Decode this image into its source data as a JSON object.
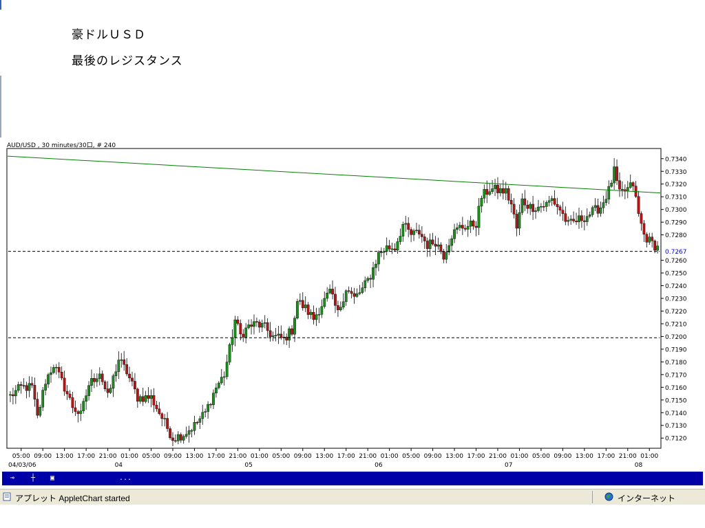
{
  "page": {
    "heading1": "豪ドルＵＳＤ",
    "heading2": "最後のレジスタンス"
  },
  "chart_data": {
    "type": "candlestick",
    "title": "AUD/USD , 30 minutes/30口, # 240",
    "current_price": "0.7267",
    "ylim": [
      0.7112,
      0.7348
    ],
    "y_ticks": [
      "0.7120",
      "0.7130",
      "0.7140",
      "0.7150",
      "0.7160",
      "0.7170",
      "0.7180",
      "0.7190",
      "0.7200",
      "0.7210",
      "0.7220",
      "0.7230",
      "0.7240",
      "0.7250",
      "0.7260",
      "0.7280",
      "0.7290",
      "0.7300",
      "0.7310",
      "0.7320",
      "0.7330",
      "0.7340"
    ],
    "x_time_ticks": [
      "05:00",
      "09:00",
      "13:00",
      "17:00",
      "21:00",
      "01:00",
      "05:00",
      "09:00",
      "13:00",
      "17:00",
      "21:00",
      "01:00",
      "05:00",
      "09:00",
      "13:00",
      "17:00",
      "21:00",
      "01:00",
      "05:00",
      "09:00",
      "13:00",
      "17:00",
      "21:00",
      "01:00",
      "05:00",
      "09:00",
      "13:00",
      "17:00",
      "21:00",
      "01:00"
    ],
    "x_date_labels": [
      {
        "label": "04/03/06",
        "bar": 0
      },
      {
        "label": "04",
        "bar": 40
      },
      {
        "label": "05",
        "bar": 88
      },
      {
        "label": "06",
        "bar": 136
      },
      {
        "label": "07",
        "bar": 184
      },
      {
        "label": "08",
        "bar": 232
      }
    ],
    "horizontal_lines": [
      0.7267,
      0.7199
    ],
    "trendline": {
      "start": 0.7342,
      "end": 0.7313
    },
    "colors": {
      "up": "#1e8c1e",
      "down": "#b01818",
      "trend": "#008000",
      "level": "#000000",
      "current": "#0000cc",
      "frame": "#000000"
    },
    "anchors": [
      {
        "bar": 0,
        "close": 0.7153
      },
      {
        "bar": 4,
        "close": 0.716
      },
      {
        "bar": 8,
        "close": 0.716
      },
      {
        "bar": 10,
        "close": 0.7136
      },
      {
        "bar": 13,
        "close": 0.7165
      },
      {
        "bar": 16,
        "close": 0.7178
      },
      {
        "bar": 20,
        "close": 0.716
      },
      {
        "bar": 23,
        "close": 0.7145
      },
      {
        "bar": 26,
        "close": 0.7138
      },
      {
        "bar": 29,
        "close": 0.7162
      },
      {
        "bar": 33,
        "close": 0.7172
      },
      {
        "bar": 36,
        "close": 0.7152
      },
      {
        "bar": 40,
        "close": 0.7182
      },
      {
        "bar": 43,
        "close": 0.7172
      },
      {
        "bar": 47,
        "close": 0.7152
      },
      {
        "bar": 52,
        "close": 0.7152
      },
      {
        "bar": 57,
        "close": 0.7132
      },
      {
        "bar": 60,
        "close": 0.712
      },
      {
        "bar": 64,
        "close": 0.7123
      },
      {
        "bar": 68,
        "close": 0.713
      },
      {
        "bar": 72,
        "close": 0.714
      },
      {
        "bar": 76,
        "close": 0.716
      },
      {
        "bar": 79,
        "close": 0.717
      },
      {
        "bar": 81,
        "close": 0.719
      },
      {
        "bar": 83,
        "close": 0.7213
      },
      {
        "bar": 85,
        "close": 0.7201
      },
      {
        "bar": 88,
        "close": 0.7208
      },
      {
        "bar": 91,
        "close": 0.721
      },
      {
        "bar": 94,
        "close": 0.7207
      },
      {
        "bar": 97,
        "close": 0.72
      },
      {
        "bar": 101,
        "close": 0.7198
      },
      {
        "bar": 104,
        "close": 0.7205
      },
      {
        "bar": 106,
        "close": 0.7228
      },
      {
        "bar": 109,
        "close": 0.7222
      },
      {
        "bar": 112,
        "close": 0.7214
      },
      {
        "bar": 115,
        "close": 0.7225
      },
      {
        "bar": 118,
        "close": 0.7235
      },
      {
        "bar": 121,
        "close": 0.7218
      },
      {
        "bar": 124,
        "close": 0.7238
      },
      {
        "bar": 127,
        "close": 0.723
      },
      {
        "bar": 130,
        "close": 0.7237
      },
      {
        "bar": 133,
        "close": 0.7248
      },
      {
        "bar": 136,
        "close": 0.7265
      },
      {
        "bar": 139,
        "close": 0.727
      },
      {
        "bar": 142,
        "close": 0.727
      },
      {
        "bar": 145,
        "close": 0.7288
      },
      {
        "bar": 148,
        "close": 0.728
      },
      {
        "bar": 151,
        "close": 0.7282
      },
      {
        "bar": 154,
        "close": 0.7272
      },
      {
        "bar": 157,
        "close": 0.7275
      },
      {
        "bar": 160,
        "close": 0.7264
      },
      {
        "bar": 163,
        "close": 0.728
      },
      {
        "bar": 166,
        "close": 0.7286
      },
      {
        "bar": 169,
        "close": 0.7287
      },
      {
        "bar": 172,
        "close": 0.7289
      },
      {
        "bar": 174,
        "close": 0.731
      },
      {
        "bar": 177,
        "close": 0.7316
      },
      {
        "bar": 180,
        "close": 0.7315
      },
      {
        "bar": 183,
        "close": 0.7314
      },
      {
        "bar": 185,
        "close": 0.7304
      },
      {
        "bar": 187,
        "close": 0.7285
      },
      {
        "bar": 189,
        "close": 0.7307
      },
      {
        "bar": 192,
        "close": 0.7302
      },
      {
        "bar": 195,
        "close": 0.7302
      },
      {
        "bar": 198,
        "close": 0.7304
      },
      {
        "bar": 200,
        "close": 0.7308
      },
      {
        "bar": 203,
        "close": 0.73
      },
      {
        "bar": 206,
        "close": 0.7288
      },
      {
        "bar": 209,
        "close": 0.7291
      },
      {
        "bar": 212,
        "close": 0.7294
      },
      {
        "bar": 215,
        "close": 0.7298
      },
      {
        "bar": 218,
        "close": 0.7302
      },
      {
        "bar": 221,
        "close": 0.7315
      },
      {
        "bar": 223,
        "close": 0.733
      },
      {
        "bar": 225,
        "close": 0.7312
      },
      {
        "bar": 228,
        "close": 0.7316
      },
      {
        "bar": 230,
        "close": 0.732
      },
      {
        "bar": 232,
        "close": 0.7296
      },
      {
        "bar": 234,
        "close": 0.728
      },
      {
        "bar": 236,
        "close": 0.7275
      },
      {
        "bar": 239,
        "close": 0.727
      }
    ]
  },
  "statusbar": {
    "text": "アプレット AppletChart started",
    "zone": "インターネット"
  },
  "toolbar": {
    "buttons": [
      "⊸",
      "┼",
      "▣",
      "..."
    ]
  }
}
